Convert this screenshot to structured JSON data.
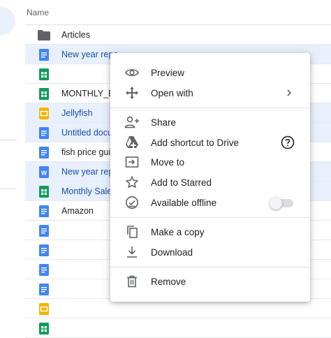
{
  "list": {
    "header": "Name",
    "rows": [
      {
        "name": "Articles",
        "type": "folder",
        "selected": false
      },
      {
        "name": "New year repo",
        "type": "doc",
        "selected": true
      },
      {
        "name": "",
        "type": "sheet",
        "selected": false
      },
      {
        "name": "MONTHLY_EX",
        "type": "sheet",
        "selected": false
      },
      {
        "name": "Jellyfish",
        "type": "slides",
        "selected": true
      },
      {
        "name": "Untitled docu",
        "type": "doc",
        "selected": true
      },
      {
        "name": "fish price guid",
        "type": "doc",
        "selected": false
      },
      {
        "name": "New year repo",
        "type": "word",
        "selected": true
      },
      {
        "name": "Monthly Sales",
        "type": "sheet",
        "selected": true
      },
      {
        "name": "Amazon",
        "type": "doc",
        "selected": false
      },
      {
        "name": "",
        "type": "doc",
        "selected": false
      },
      {
        "name": "",
        "type": "doc",
        "selected": false
      },
      {
        "name": "",
        "type": "doc",
        "selected": false
      },
      {
        "name": "",
        "type": "doc",
        "selected": false
      },
      {
        "name": "",
        "type": "slides",
        "selected": false
      },
      {
        "name": "",
        "type": "sheet",
        "selected": false
      }
    ]
  },
  "menu": {
    "preview": "Preview",
    "open_with": "Open with",
    "share": "Share",
    "add_shortcut": "Add shortcut to Drive",
    "move_to": "Move to",
    "add_starred": "Add to Starred",
    "available_offline": "Available offline",
    "make_copy": "Make a copy",
    "download": "Download",
    "remove": "Remove",
    "offline_enabled": false
  },
  "colors": {
    "doc": "#4285f4",
    "sheet": "#0f9d58",
    "slides": "#f4b400",
    "word": "#4285f4",
    "folder": "#5f6368",
    "selection": "#e8f0fe"
  }
}
